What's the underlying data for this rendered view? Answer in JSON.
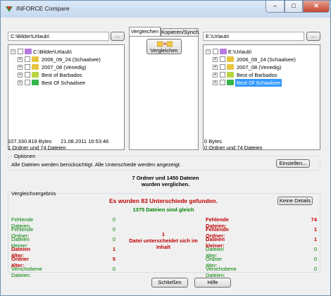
{
  "window": {
    "title": "INFORCE Compare",
    "minimize": "–",
    "maximize": "□",
    "close": "✕"
  },
  "left": {
    "path": "C:\\Bilder\\Urlaub\\",
    "browse_label": "...",
    "tree": {
      "root": "C:\\Bilder\\Urlaub\\",
      "items": [
        "2006_09_24 (Schaalsee)",
        "2007_08 (Venedig)",
        "Best of Barbados",
        "Best Of Schaalsee"
      ]
    },
    "stats_line1": "107.330.819 Bytes      21.08.2011 16:53:46",
    "stats_line2": "1 Ordner und 74 Dateien"
  },
  "right": {
    "path": "E:\\Urlaub\\",
    "browse_label": "...",
    "tree": {
      "root": "E:\\Urlaub\\",
      "items": [
        "2006_09_24 (Schaalsee)",
        "2007_08 (Venedig)",
        "Best of Barbados",
        "Best Of Schaalsee"
      ],
      "selected_index": 3
    },
    "stats_line1": "0 Bytes",
    "stats_line2": "0 Ordner und 74 Dateien"
  },
  "center": {
    "tabs": [
      "Vergleichen",
      "Kopieren/Synch."
    ],
    "active_tab": 0,
    "compare_button": "Vergleichen"
  },
  "options": {
    "title": "Optionen",
    "text": "Alle Dateien werden berücksichtigt. Alle Unterschiede werden angezeigt.",
    "settings_button": "Einstellen..."
  },
  "summary": {
    "line1": "7 Ordner und 1450 Dateien",
    "line2": "wurden verglichen."
  },
  "result": {
    "title": "Vergleichsergebnis",
    "headline": "Es wurden 83 Unterschiede gefunden.",
    "same": "1375 Dateien sind gleich",
    "details_button": "Keine Details",
    "middle_count": "1",
    "middle_line1": "Datei unterscheidet sich im",
    "middle_line2": "Inhalt",
    "left_rows": [
      {
        "label": "Fehlende Dateien:",
        "value": "0",
        "style": "green"
      },
      {
        "label": "Fehlende Ordner:",
        "value": "0",
        "style": "green"
      },
      {
        "label": "Dateien kleiner:",
        "value": "0",
        "style": "green"
      },
      {
        "label": "Dateien älter:",
        "value": "1",
        "style": "red"
      },
      {
        "label": "Ordner älter:",
        "value": "5",
        "style": "red"
      },
      {
        "label": "Verschobene Dateien:",
        "value": "0",
        "style": "green"
      }
    ],
    "right_rows": [
      {
        "label": "Fehlende Dateien:",
        "value": "74",
        "style": "red"
      },
      {
        "label": "Fehlende Ordner:",
        "value": "1",
        "style": "red"
      },
      {
        "label": "Dateien kleiner:",
        "value": "1",
        "style": "red"
      },
      {
        "label": "Dateien älter:",
        "value": "0",
        "style": "green"
      },
      {
        "label": "Ordner älter:",
        "value": "0",
        "style": "green"
      },
      {
        "label": "Verschobene Dateien:",
        "value": "0",
        "style": "green"
      }
    ]
  },
  "footer": {
    "close_button": "Schließen",
    "help_button": "Hilfe"
  },
  "colors": {
    "red": "#c00000",
    "green": "#008000",
    "selection": "#3399ff",
    "folder_yellow": "#f2c744"
  },
  "icons": {
    "folder": "folder-icon",
    "app": "app-icon",
    "compare": "compare-folders-icon"
  }
}
